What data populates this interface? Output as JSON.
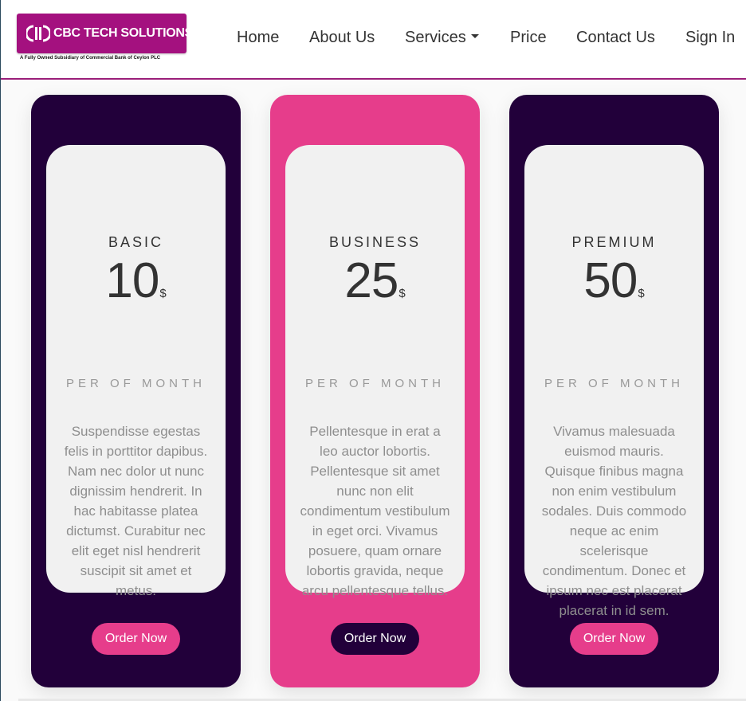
{
  "brand": {
    "name": "CBC TECH SOLUTIONS",
    "tagline": "A Fully Owned Subsidiary of Commercial Bank of Ceylon PLC",
    "color": "#a4117f"
  },
  "nav": {
    "home": "Home",
    "about": "About Us",
    "services": "Services",
    "price": "Price",
    "contact": "Contact Us",
    "signin": "Sign In"
  },
  "plans": [
    {
      "name": "BASIC",
      "price": "10",
      "currency": "$",
      "period": "PER OF MONTH",
      "description": "Suspendisse egestas felis in porttitor dapibus. Nam nec dolor ut nunc dignissim hendrerit. In hac habitasse platea dictumst. Curabitur nec elit eget nisl hendrerit suscipit sit amet et metus.",
      "button": "Order Now"
    },
    {
      "name": "BUSINESS",
      "price": "25",
      "currency": "$",
      "period": "PER OF MONTH",
      "description": "Pellentesque in erat a leo auctor lobortis. Pellentesque sit amet nunc non elit condimentum vestibulum in eget orci. Vivamus posuere, quam ornare lobortis gravida, neque arcu pellentesque tellus.",
      "button": "Order Now"
    },
    {
      "name": "PREMIUM",
      "price": "50",
      "currency": "$",
      "period": "PER OF MONTH",
      "description": "Vivamus malesuada euismod mauris. Quisque finibus magna non enim vestibulum sodales. Duis commodo neque ac enim scelerisque condimentum. Donec et ipsum nec est placerat placerat in id sem.",
      "button": "Order Now"
    }
  ],
  "colors": {
    "dark": "#22003a",
    "pink": "#e63d8b",
    "card_inner": "#f1f1f1"
  }
}
